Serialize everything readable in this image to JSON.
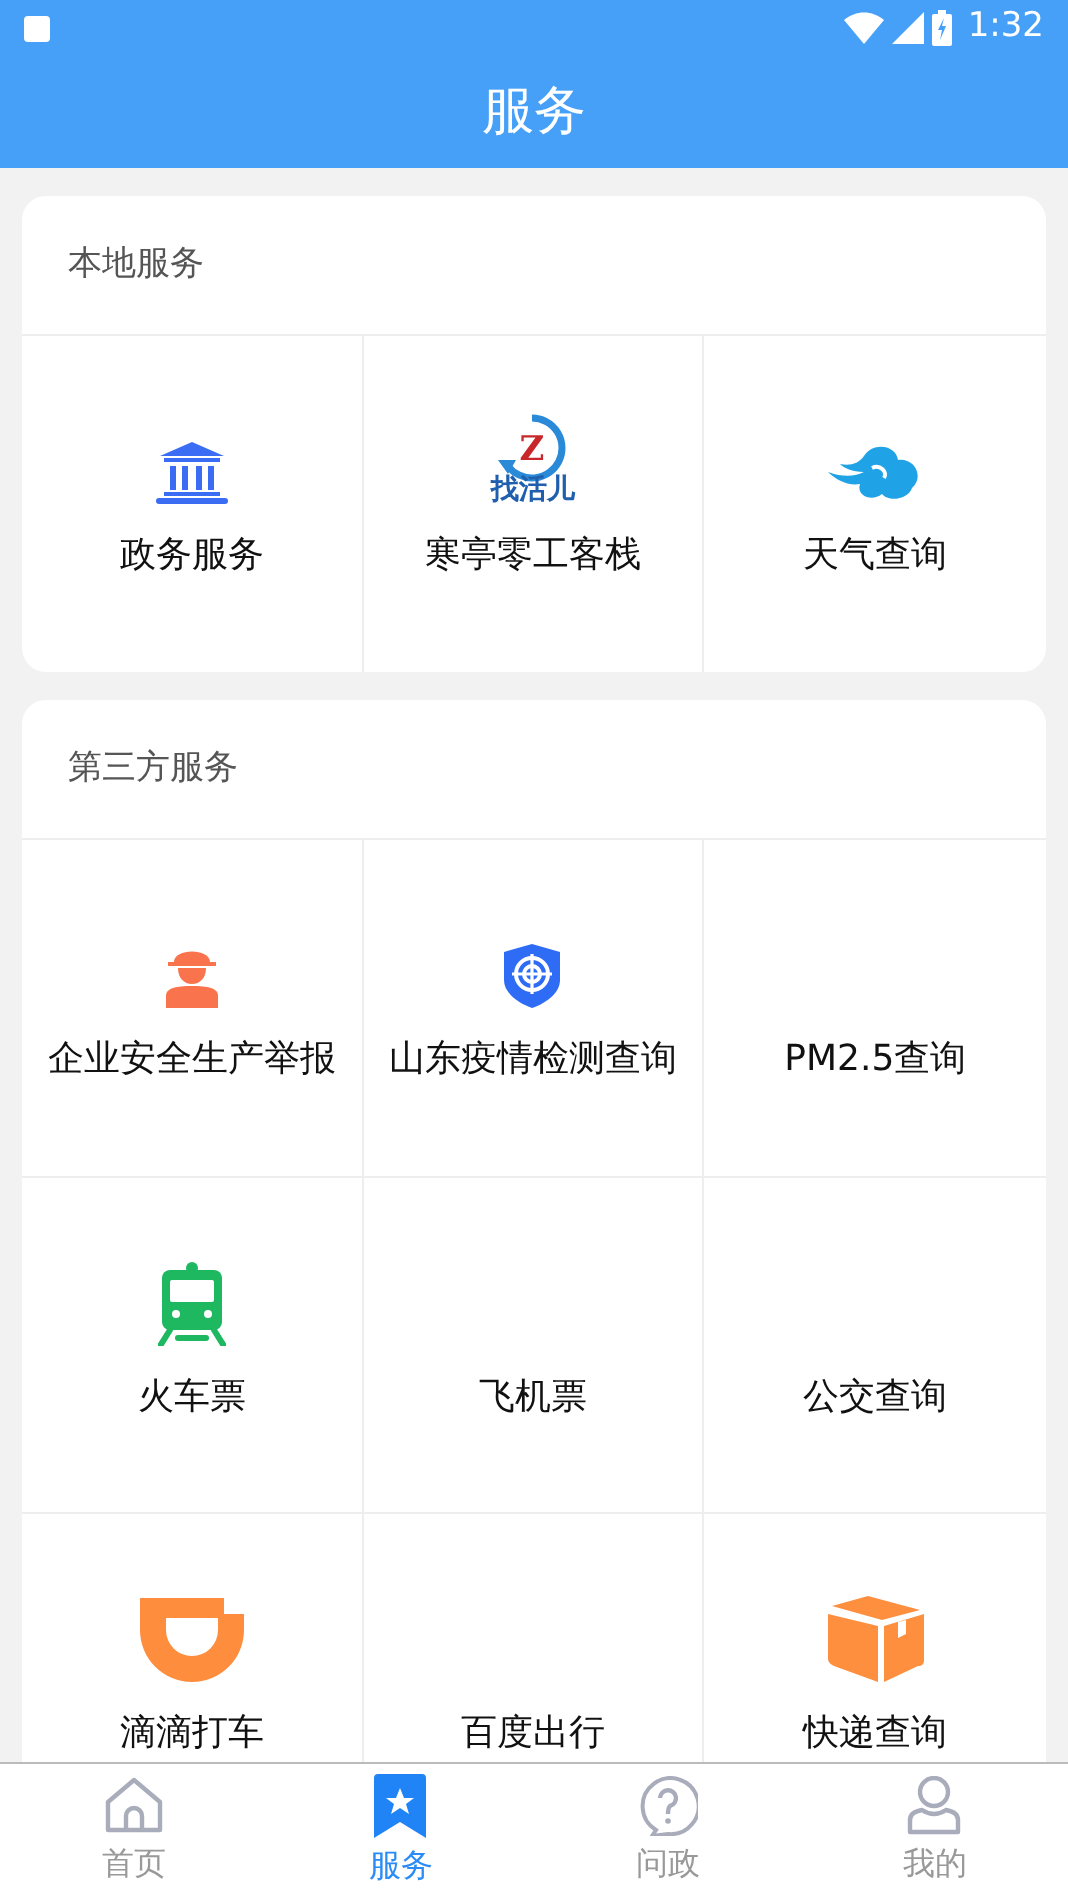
{
  "status_bar": {
    "time": "1:32"
  },
  "header": {
    "title": "服务"
  },
  "sections": [
    {
      "title": "本地服务",
      "items": [
        {
          "label": "政务服务"
        },
        {
          "label": "寒亭零工客栈",
          "logo_text": "找活儿",
          "logo_letter": "Z"
        },
        {
          "label": "天气查询"
        }
      ]
    },
    {
      "title": "第三方服务",
      "items": [
        {
          "label": "企业安全生产举报"
        },
        {
          "label": "山东疫情检测查询"
        },
        {
          "label": "PM2.5查询"
        },
        {
          "label": "火车票"
        },
        {
          "label": "飞机票"
        },
        {
          "label": "公交查询"
        },
        {
          "label": "滴滴打车"
        },
        {
          "label": "百度出行"
        },
        {
          "label": "快递查询"
        }
      ]
    }
  ],
  "tab_bar": [
    {
      "label": "首页",
      "selected": false
    },
    {
      "label": "服务",
      "selected": true
    },
    {
      "label": "问政",
      "selected": false
    },
    {
      "label": "我的",
      "selected": false
    }
  ]
}
